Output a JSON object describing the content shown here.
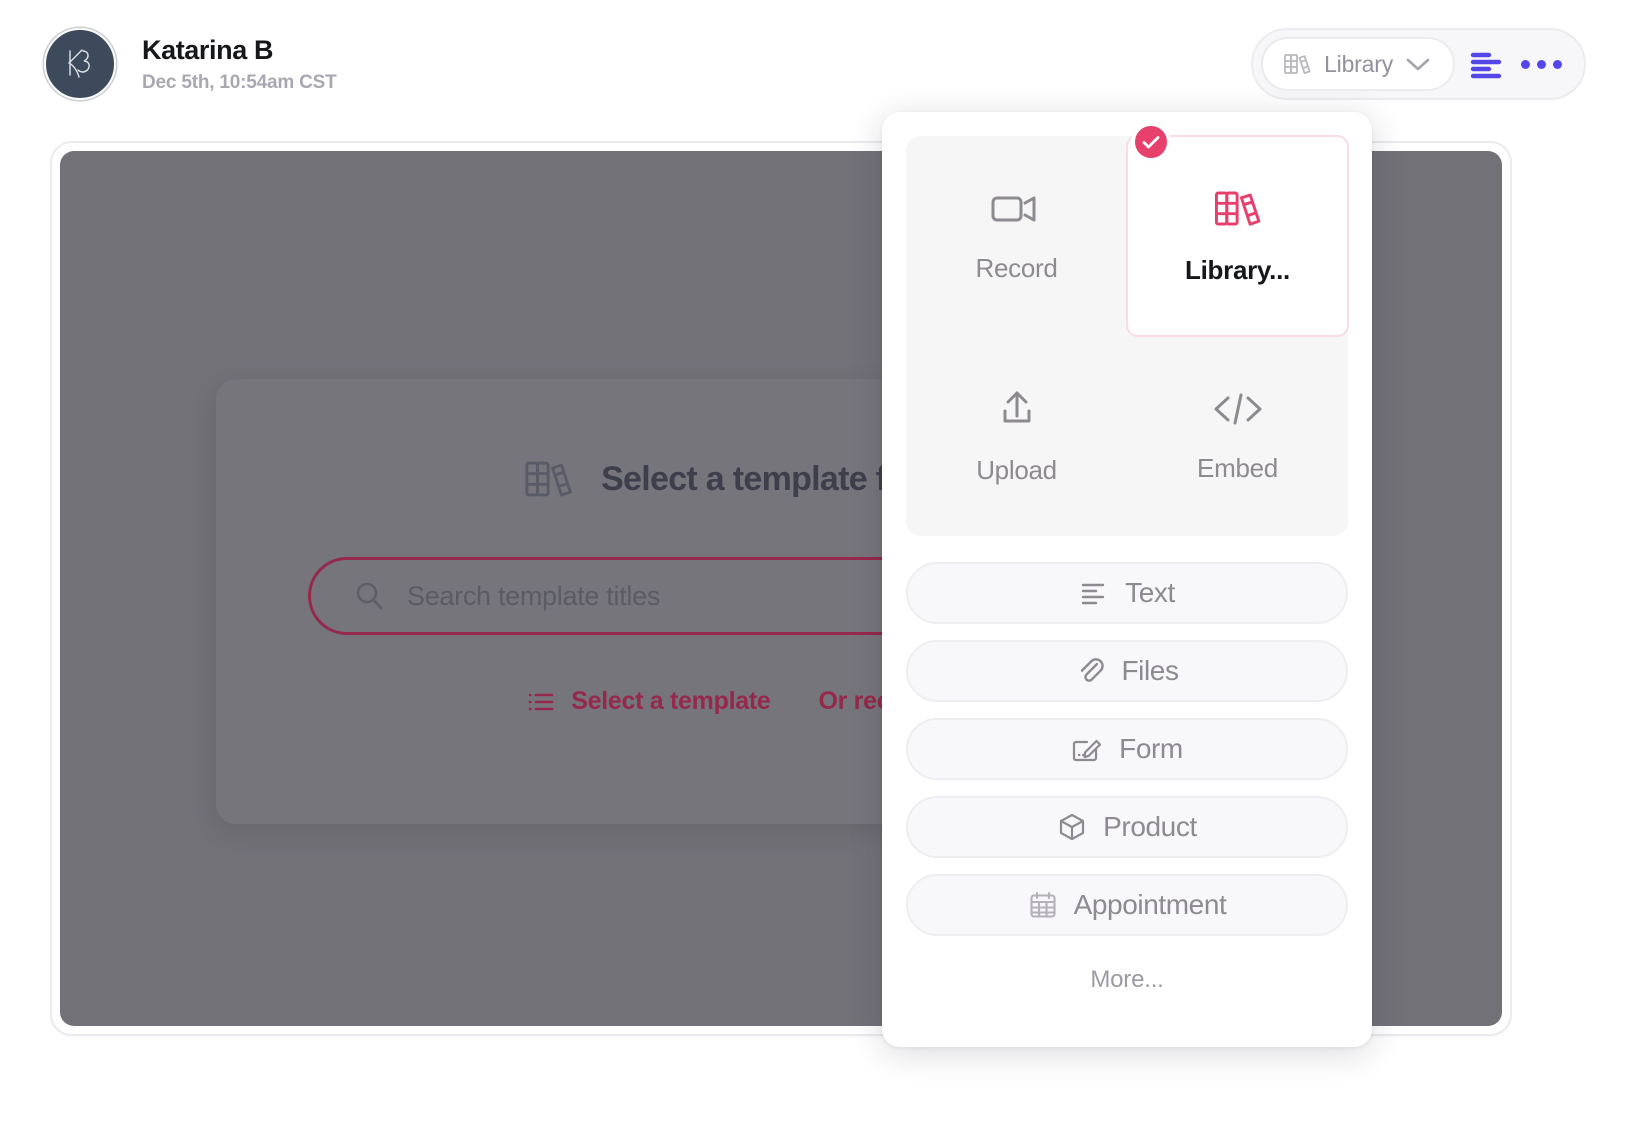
{
  "header": {
    "avatar_initials": "KB",
    "user_name": "Katarina B",
    "timestamp": "Dec 5th, 10:54am CST",
    "library_button_label": "Library",
    "library_icon": "books-icon",
    "chevron_icon": "chevron-down-icon",
    "list_view_icon": "align-left-icon",
    "overflow_icon": "ellipsis-icon",
    "accent_indigo": "#5546e8"
  },
  "modal": {
    "title": "Select a template fro",
    "title_icon": "books-icon",
    "search": {
      "placeholder": "Search template titles",
      "value": "",
      "icon": "search-icon",
      "border_color": "#96284b"
    },
    "links": [
      {
        "label": "Select a template",
        "icon": "list-icon"
      },
      {
        "label": "Or recor",
        "icon": ""
      }
    ],
    "accent_crimson": "#96284b",
    "overlay_color": "#737178"
  },
  "panel": {
    "grid": [
      {
        "label": "Record",
        "icon": "video-camera-icon",
        "selected": false
      },
      {
        "label": "Library...",
        "icon": "books-icon",
        "selected": true
      },
      {
        "label": "Upload",
        "icon": "upload-icon",
        "selected": false
      },
      {
        "label": "Embed",
        "icon": "code-icon",
        "selected": false
      }
    ],
    "selected_badge_icon": "check-icon",
    "selected_badge_color": "#e8406c",
    "list": [
      {
        "label": "Text",
        "icon": "align-left-icon"
      },
      {
        "label": "Files",
        "icon": "paperclip-icon"
      },
      {
        "label": "Form",
        "icon": "form-edit-icon"
      },
      {
        "label": "Product",
        "icon": "cube-icon"
      },
      {
        "label": "Appointment",
        "icon": "calendar-icon"
      }
    ],
    "more_label": "More..."
  }
}
